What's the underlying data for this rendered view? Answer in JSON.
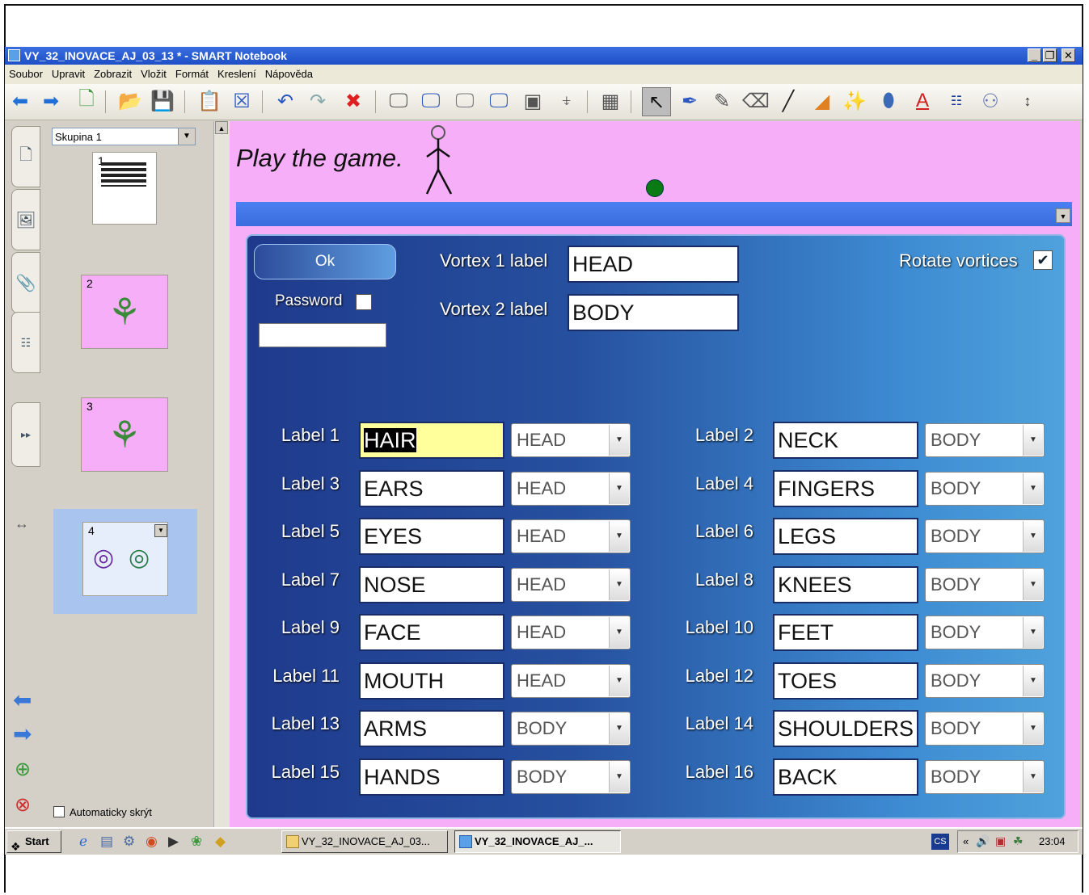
{
  "window": {
    "title": "VY_32_INOVACE_AJ_03_13 * - SMART Notebook",
    "controls": [
      "_",
      "❐",
      "✕"
    ]
  },
  "menu": [
    "Soubor",
    "Upravit",
    "Zobrazit",
    "Vložit",
    "Formát",
    "Kreslení",
    "Nápověda"
  ],
  "sorter": {
    "group": "Skupina 1",
    "pages": [
      "1",
      "2",
      "3",
      "4"
    ],
    "autohide_label": "Automaticky skrýt"
  },
  "canvas": {
    "title": "Play the game.",
    "background": "#f7aef8"
  },
  "panel": {
    "ok_label": "Ok",
    "password_label": "Password",
    "vortex1_label": "Vortex 1 label",
    "vortex1_value": "HEAD",
    "vortex2_label": "Vortex 2 label",
    "vortex2_value": "BODY",
    "rotate_label": "Rotate vortices",
    "rotate_checked": "✔",
    "labels": [
      {
        "name": "Label 1",
        "value": "HAIR",
        "group": "HEAD"
      },
      {
        "name": "Label 2",
        "value": "NECK",
        "group": "BODY"
      },
      {
        "name": "Label 3",
        "value": "EARS",
        "group": "HEAD"
      },
      {
        "name": "Label 4",
        "value": "FINGERS",
        "group": "BODY"
      },
      {
        "name": "Label 5",
        "value": "EYES",
        "group": "HEAD"
      },
      {
        "name": "Label 6",
        "value": "LEGS",
        "group": "BODY"
      },
      {
        "name": "Label 7",
        "value": "NOSE",
        "group": "HEAD"
      },
      {
        "name": "Label 8",
        "value": "KNEES",
        "group": "BODY"
      },
      {
        "name": "Label 9",
        "value": "FACE",
        "group": "HEAD"
      },
      {
        "name": "Label 10",
        "value": "FEET",
        "group": "BODY"
      },
      {
        "name": "Label 11",
        "value": "MOUTH",
        "group": "HEAD"
      },
      {
        "name": "Label 12",
        "value": "TOES",
        "group": "BODY"
      },
      {
        "name": "Label 13",
        "value": "ARMS",
        "group": "BODY"
      },
      {
        "name": "Label 14",
        "value": "SHOULDERS",
        "group": "BODY"
      },
      {
        "name": "Label 15",
        "value": "HANDS",
        "group": "BODY"
      },
      {
        "name": "Label 16",
        "value": "BACK",
        "group": "BODY"
      }
    ]
  },
  "taskbar": {
    "start_label": "Start",
    "tasks": [
      "VY_32_INOVACE_AJ_03...",
      "VY_32_INOVACE_AJ_..."
    ],
    "lang": "CS",
    "chevron": "«",
    "clock": "23:04"
  },
  "colors": {
    "titlebar": "#1e4fc6",
    "panel_dark": "#1f3a8c",
    "panel_light": "#4fa2dc",
    "canvas_pink": "#f7aef8",
    "handle_green": "#0a7a14"
  }
}
